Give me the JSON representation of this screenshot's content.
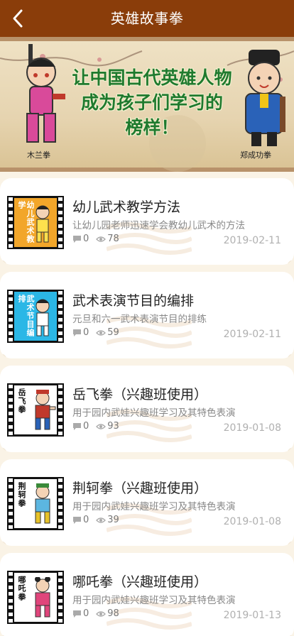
{
  "header": {
    "title": "英雄故事拳"
  },
  "banner": {
    "slogan_line1": "让中国古代英雄人物",
    "slogan_line2": "成为孩子们学习的",
    "slogan_line3": "榜样！",
    "caption_left": "木兰拳",
    "caption_right": "郑成功拳"
  },
  "items": [
    {
      "title": "幼儿武术教学方法",
      "desc": "让幼儿园老师迅速学会教幼儿武术的方法",
      "comments": "0",
      "views": "78",
      "date": "2019-02-11",
      "thumb_text": "幼儿武术教学",
      "thumb_bg": "#f2a62a",
      "thumb_text_color": "#ffffff"
    },
    {
      "title": "武术表演节目的编排",
      "desc": "元旦和六一武术表演节目的排练",
      "comments": "0",
      "views": "59",
      "date": "2019-02-11",
      "thumb_text": "武术节目编排",
      "thumb_bg": "#2bb7e6",
      "thumb_text_color": "#ffffff"
    },
    {
      "title": "岳飞拳（兴趣班使用）",
      "desc": "用于园内武娃兴趣班学习及其特色表演",
      "comments": "0",
      "views": "93",
      "date": "2019-01-08",
      "thumb_text": "岳飞拳",
      "thumb_bg": "#ffffff",
      "thumb_text_color": "#111111"
    },
    {
      "title": "荆轲拳（兴趣班使用）",
      "desc": "用于园内武娃兴趣班学习及其特色表演",
      "comments": "0",
      "views": "39",
      "date": "2019-01-08",
      "thumb_text": "荆轲拳",
      "thumb_bg": "#ffffff",
      "thumb_text_color": "#111111"
    },
    {
      "title": "哪吒拳（兴趣班使用）",
      "desc": "用于园内武娃兴趣班学习及其特色表演",
      "comments": "0",
      "views": "98",
      "date": "2019-01-13",
      "thumb_text": "哪吒拳",
      "thumb_bg": "#ffffff",
      "thumb_text_color": "#111111"
    }
  ],
  "icons": {
    "comment": "comment-icon",
    "views": "eye-icon",
    "back": "chevron-left-icon"
  },
  "colors": {
    "header_bg": "#8a3d0a",
    "slogan": "#1f7a2e",
    "page_bg": "#faf3e6"
  }
}
